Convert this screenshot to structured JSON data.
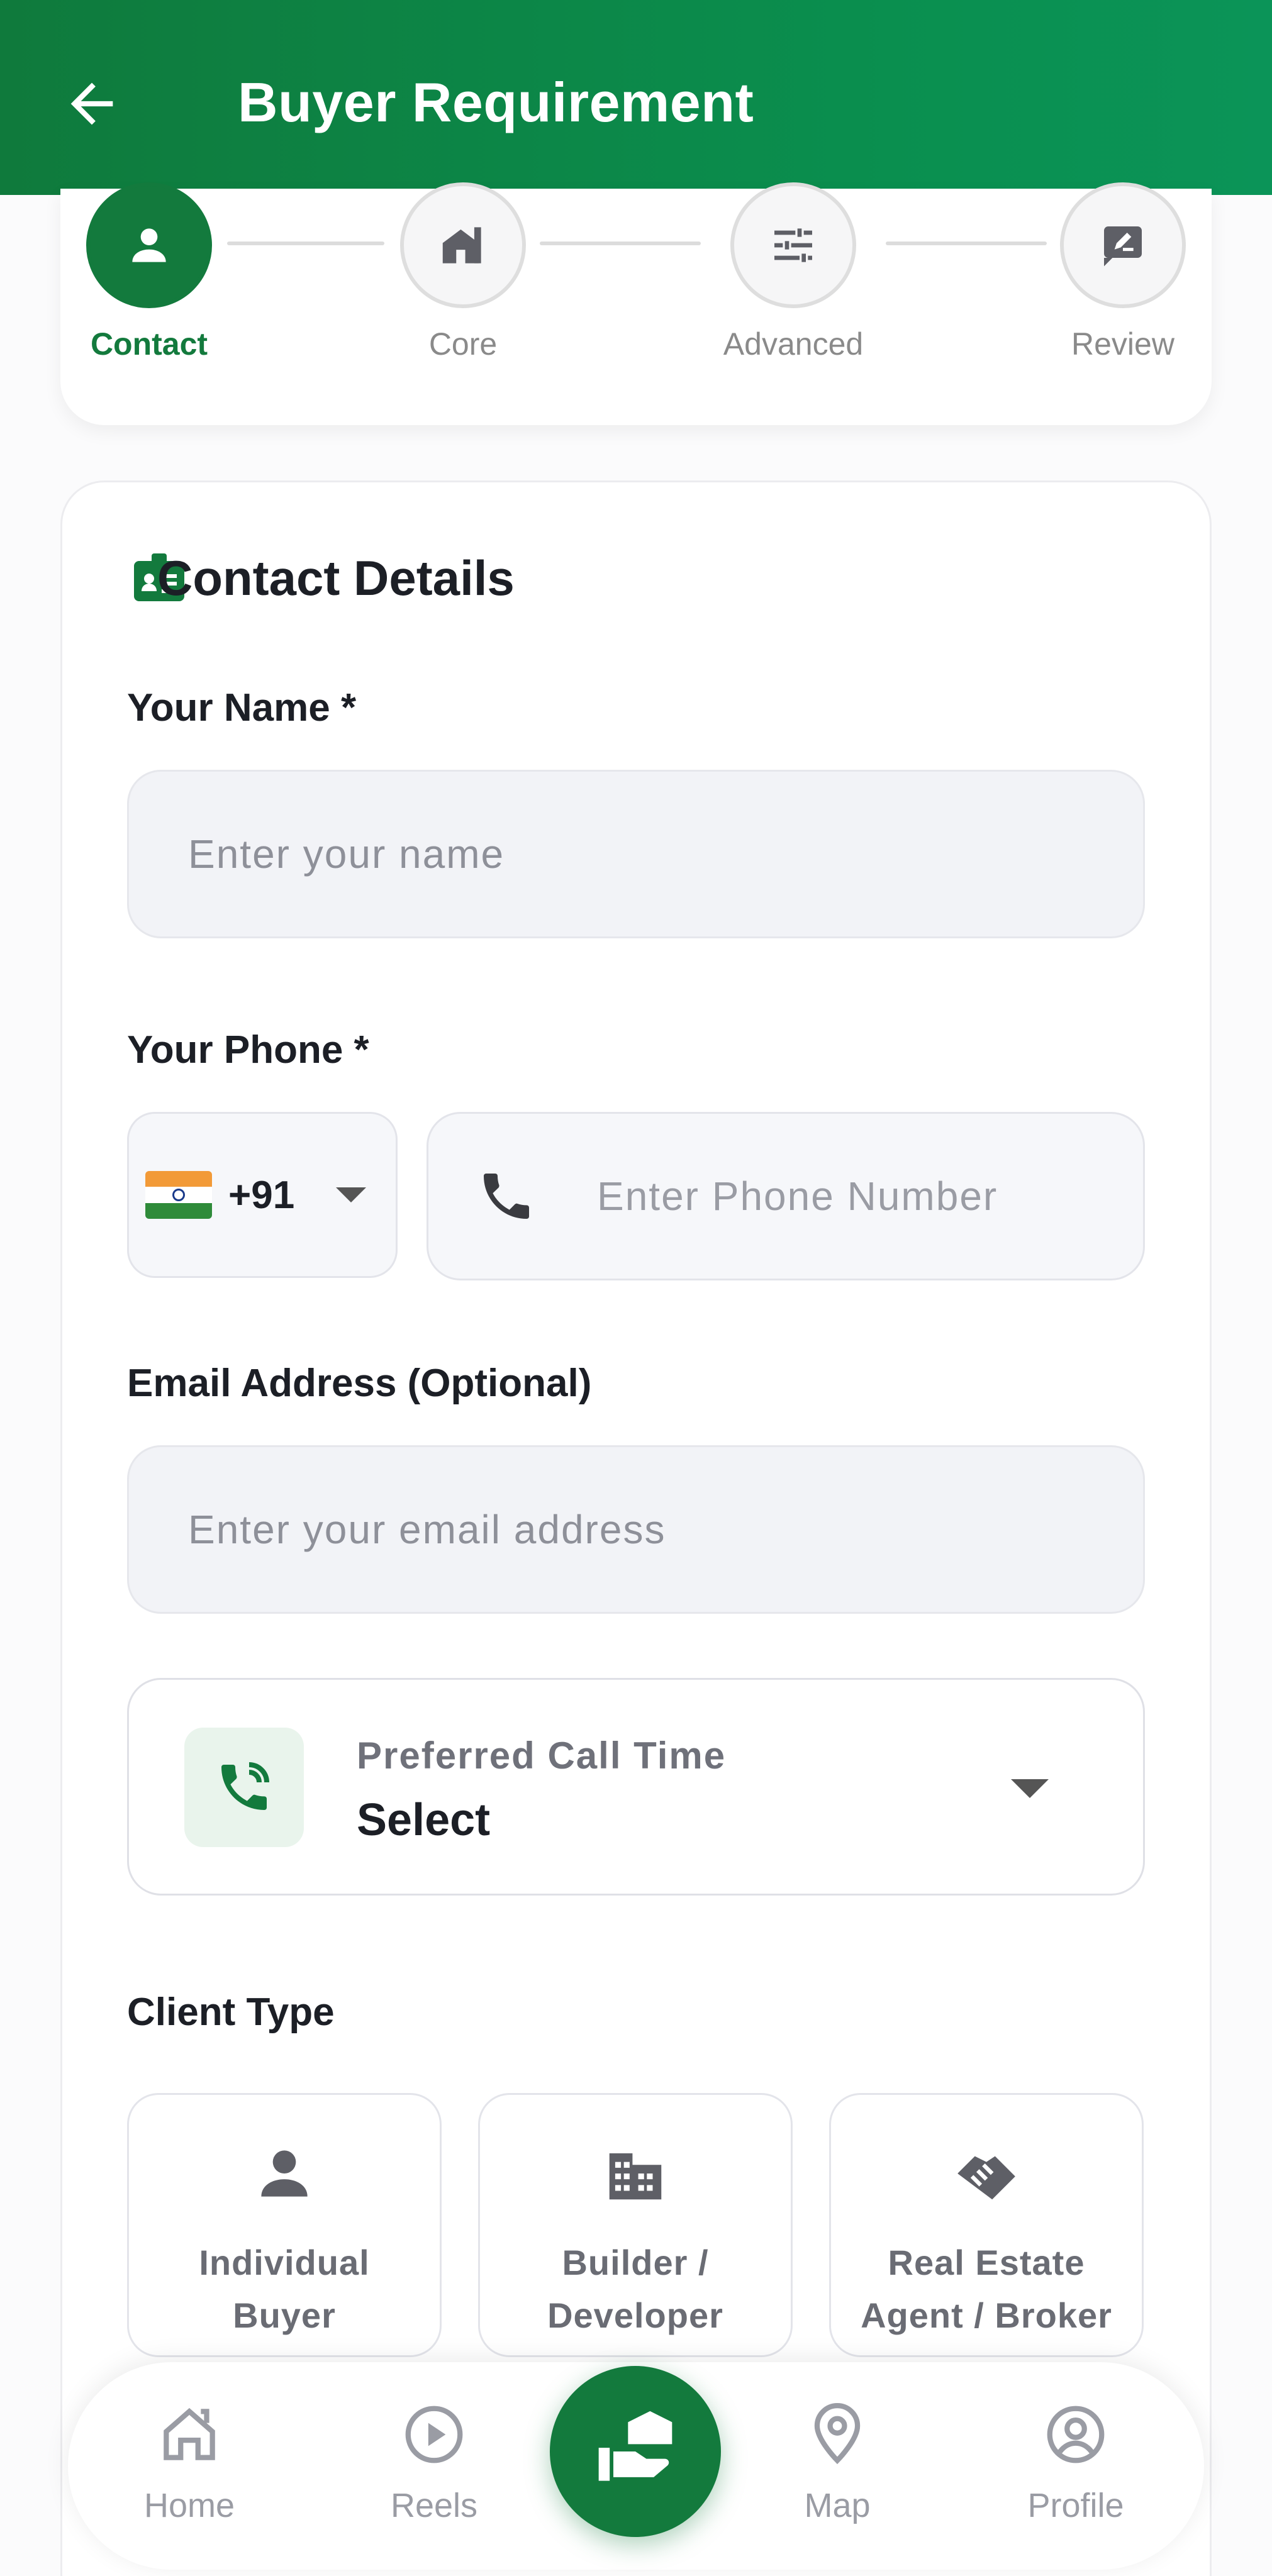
{
  "header": {
    "title": "Buyer Requirement",
    "back_icon": "arrow-left-icon"
  },
  "stepper": {
    "steps": [
      {
        "label": "Contact",
        "icon": "person-icon",
        "active": true
      },
      {
        "label": "Core",
        "icon": "house-icon",
        "active": false
      },
      {
        "label": "Advanced",
        "icon": "sliders-icon",
        "active": false
      },
      {
        "label": "Review",
        "icon": "edit-review-icon",
        "active": false
      }
    ]
  },
  "form": {
    "section_title": "Contact Details",
    "name": {
      "label": "Your Name *",
      "placeholder": "Enter your name",
      "value": ""
    },
    "phone": {
      "label": "Your Phone *",
      "country_code": "+91",
      "placeholder": "Enter Phone Number",
      "value": ""
    },
    "email": {
      "label": "Email Address (Optional)",
      "placeholder": "Enter your email address",
      "value": ""
    },
    "call_time": {
      "label": "Preferred Call Time",
      "value": "Select"
    },
    "client_type": {
      "label": "Client Type",
      "options": [
        {
          "line1": "Individual",
          "line2": "Buyer",
          "icon": "person-icon"
        },
        {
          "line1": "Builder /",
          "line2": "Developer",
          "icon": "building-icon"
        },
        {
          "line1": "Real Estate",
          "line2": "Agent / Broker",
          "icon": "handshake-icon"
        }
      ]
    }
  },
  "bottom_nav": {
    "items": [
      {
        "label": "Home",
        "icon": "home-icon"
      },
      {
        "label": "Reels",
        "icon": "play-icon"
      },
      {
        "label": "Map",
        "icon": "map-pin-icon"
      },
      {
        "label": "Profile",
        "icon": "profile-icon"
      }
    ],
    "center_icon": "hand-house-icon"
  },
  "colors": {
    "primary": "#137a3d",
    "header_gradient_end": "#0b9458",
    "input_bg": "#f2f3f7"
  }
}
